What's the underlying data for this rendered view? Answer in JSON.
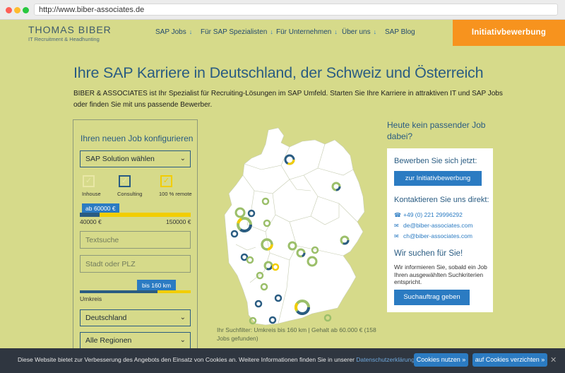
{
  "browser": {
    "url": "http://www.biber-associates.de"
  },
  "header": {
    "logo_main": "THOMAS BIBER",
    "logo_sub": "IT Recruitment & Headhunting",
    "nav": [
      {
        "label": "SAP Jobs",
        "arrow": "↓"
      },
      {
        "label": "Für SAP Spezialisten",
        "arrow": "↓"
      },
      {
        "label": "Für Unternehmen",
        "arrow": "↓"
      },
      {
        "label": "Über uns",
        "arrow": "↓"
      },
      {
        "label": "SAP Blog",
        "arrow": ""
      }
    ],
    "cta": "Initiativbewerbung"
  },
  "hero": {
    "title": "Ihre SAP Karriere in Deutschland, der Schweiz und Österreich",
    "intro": "BIBER & ASSOCIATES ist Ihr Spezialist für Recruiting-Lösungen im SAP Umfeld. Starten Sie Ihre Karriere in attraktiven IT und SAP Jobs oder finden Sie mit uns passende Bewerber."
  },
  "filter": {
    "title": "Ihren neuen Job konfigurieren",
    "solution_select": "SAP Solution wählen",
    "checkboxes": [
      {
        "label": "Inhouse",
        "checked": false
      },
      {
        "label": "Consulting",
        "checked": true
      },
      {
        "label": "100 % remote",
        "checked": false
      }
    ],
    "salary_badge": "ab 60000 €",
    "salary_fraction": 0.18,
    "salary_min": "40000 €",
    "salary_max": "150000 €",
    "text_placeholder": "Textsuche",
    "city_placeholder": "Stadt oder PLZ",
    "radius_badge": "bis 160 km",
    "radius_fraction": 0.7,
    "radius_label": "Umkreis",
    "country_select": "Deutschland",
    "region_select": "Alle Regionen"
  },
  "map": {
    "caption": "Ihr Suchfilter: Umkreis bis 160 km | Gehalt ab 60.000 € (158 Jobs gefunden)"
  },
  "sidebar": {
    "heading": "Heute kein passender Job dabei?",
    "apply_heading": "Bewerben Sie sich jetzt:",
    "apply_button": "zur Initiativbewerbung",
    "contact_heading": "Kontaktieren Sie uns direkt:",
    "phone": "+49 (0) 221 29996292",
    "email_de": "de@biber-associates.com",
    "email_ch": "ch@biber-associates.com",
    "search_heading": "Wir suchen für Sie!",
    "search_text": "Wir informieren Sie, sobald ein Job Ihren ausgewählten Suchkriterien entspricht.",
    "search_button": "Suchauftrag geben"
  },
  "cookie": {
    "text": "Diese Website bietet zur Verbesserung des Angebots den Einsatz von Cookies an. Weitere Informationen finden Sie in unserer",
    "link": "Datenschutzerklärung »",
    "accept": "Cookies nutzen »",
    "decline": "auf Cookies verzichten »",
    "close": "✕"
  },
  "colors": {
    "page_bg": "#d6da8a",
    "brand_blue": "#2a5c82",
    "accent_blue": "#2b7bc2",
    "orange": "#f7931e",
    "yellow": "#f2cd00"
  }
}
